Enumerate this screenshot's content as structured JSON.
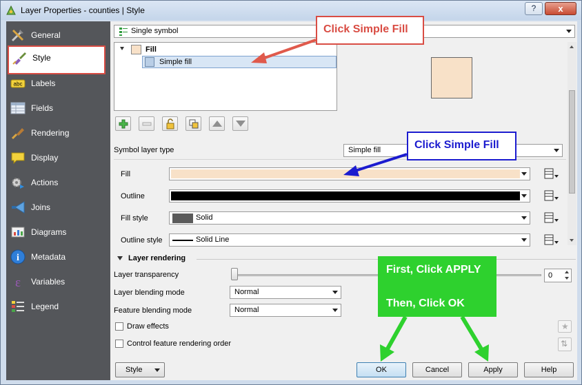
{
  "window": {
    "title": "Layer Properties - counties | Style",
    "help": "?",
    "close": "x"
  },
  "sidebar": {
    "items": [
      {
        "label": "General"
      },
      {
        "label": "Style"
      },
      {
        "label": "Labels"
      },
      {
        "label": "Fields"
      },
      {
        "label": "Rendering"
      },
      {
        "label": "Display"
      },
      {
        "label": "Actions"
      },
      {
        "label": "Joins"
      },
      {
        "label": "Diagrams"
      },
      {
        "label": "Metadata"
      },
      {
        "label": "Variables"
      },
      {
        "label": "Legend"
      }
    ]
  },
  "renderer": {
    "value": "Single symbol"
  },
  "symbol_tree": {
    "root": "Fill",
    "child": "Simple fill"
  },
  "symbol_layer_type": {
    "label": "Symbol layer type",
    "value": "Simple fill"
  },
  "properties": {
    "fill": {
      "label": "Fill"
    },
    "outline": {
      "label": "Outline"
    },
    "fill_style": {
      "label": "Fill style",
      "value": "Solid"
    },
    "outline_style": {
      "label": "Outline style",
      "value": "Solid Line"
    }
  },
  "layer_rendering": {
    "header": "Layer rendering",
    "transparency_label": "Layer transparency",
    "transparency_value": "0",
    "transparency_level": 0,
    "blend_label": "Layer blending mode",
    "blend_value": "Normal",
    "feature_blend_label": "Feature blending mode",
    "feature_blend_value": "Normal",
    "draw_effects": "Draw effects",
    "control_order": "Control feature rendering order"
  },
  "buttons": {
    "style": "Style",
    "ok": "OK",
    "cancel": "Cancel",
    "apply": "Apply",
    "help": "Help"
  },
  "annotations": {
    "red": "Click Simple Fill",
    "blue": "Click Simple Fill",
    "green_line1": "First, Click APPLY",
    "green_line2": "Then, Click OK"
  },
  "colors": {
    "fill": "#f8e1c8",
    "outline": "#000000",
    "accent_red": "#d94c43",
    "accent_blue": "#1b1bcf",
    "accent_green": "#2ed12e"
  }
}
